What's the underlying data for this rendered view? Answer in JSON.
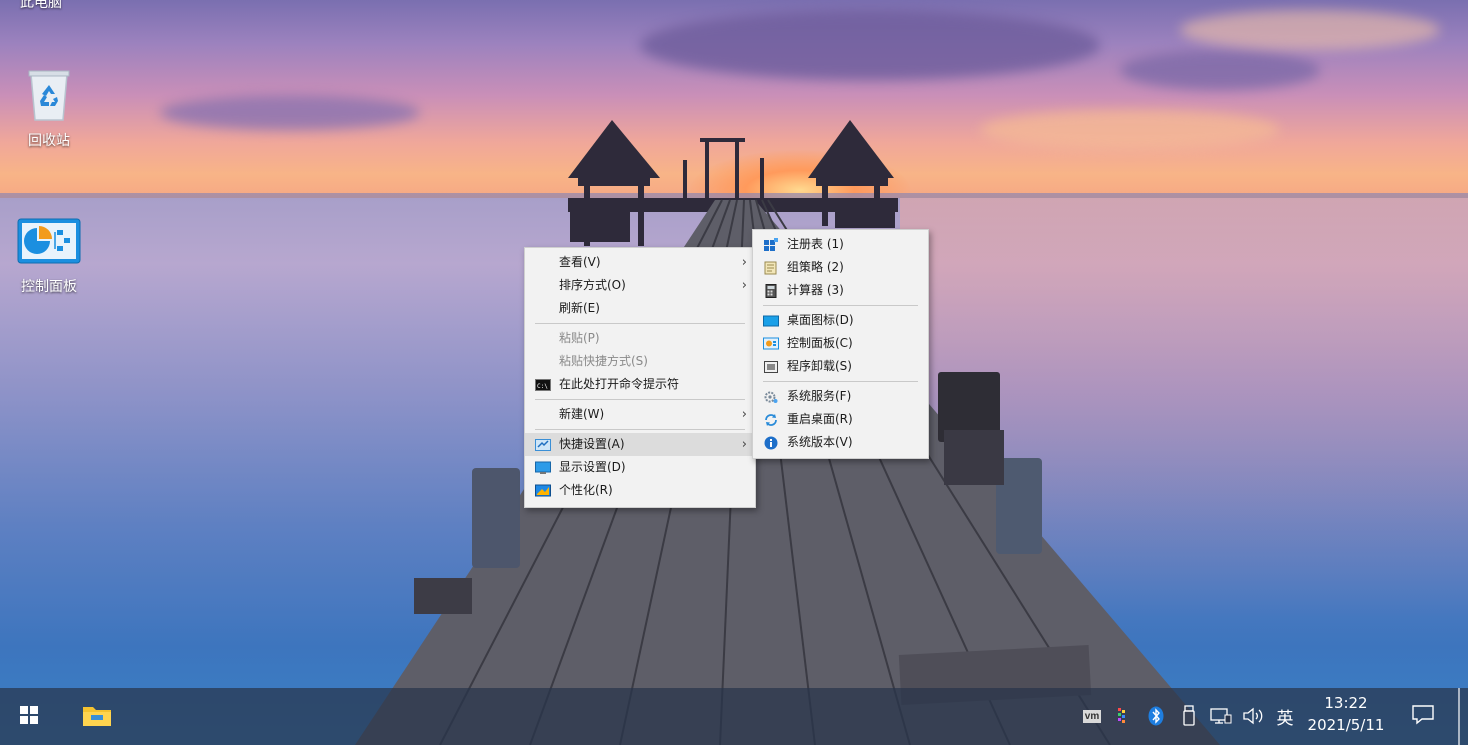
{
  "desktop": {
    "partial_icon_label": "此电脑",
    "icons": [
      {
        "label": "回收站",
        "icon": "recycle-bin-icon"
      },
      {
        "label": "控制面板",
        "icon": "control-panel-icon"
      }
    ]
  },
  "context_menu": {
    "items": [
      {
        "label": "查看(V)",
        "submenu": true
      },
      {
        "label": "排序方式(O)",
        "submenu": true
      },
      {
        "label": "刷新(E)"
      },
      {
        "label": "粘贴(P)",
        "disabled": true
      },
      {
        "label": "粘贴快捷方式(S)",
        "disabled": true
      },
      {
        "label": "在此处打开命令提示符",
        "icon": "cmd-icon"
      },
      {
        "label": "新建(W)",
        "submenu": true
      },
      {
        "label": "快捷设置(A)",
        "submenu": true,
        "icon": "quick-settings-icon"
      },
      {
        "label": "显示设置(D)",
        "icon": "display-icon"
      },
      {
        "label": "个性化(R)",
        "icon": "personalize-icon"
      }
    ]
  },
  "quick_settings_menu": {
    "items": [
      {
        "label": "注册表  (1)",
        "icon": "registry-icon"
      },
      {
        "label": "组策略  (2)",
        "icon": "group-policy-icon"
      },
      {
        "label": "计算器  (3)",
        "icon": "calculator-icon"
      },
      {
        "label": "桌面图标(D)",
        "icon": "desktop-icons-icon"
      },
      {
        "label": "控制面板(C)",
        "icon": "control-panel-icon"
      },
      {
        "label": "程序卸载(S)",
        "icon": "uninstall-icon"
      },
      {
        "label": "系统服务(F)",
        "icon": "services-icon"
      },
      {
        "label": "重启桌面(R)",
        "icon": "restart-desktop-icon"
      },
      {
        "label": "系统版本(V)",
        "icon": "info-icon"
      }
    ]
  },
  "taskbar": {
    "tray": {
      "vm_label": "vm",
      "ime_label": "英"
    },
    "clock": {
      "time": "13:22",
      "date": "2021/5/11"
    }
  }
}
